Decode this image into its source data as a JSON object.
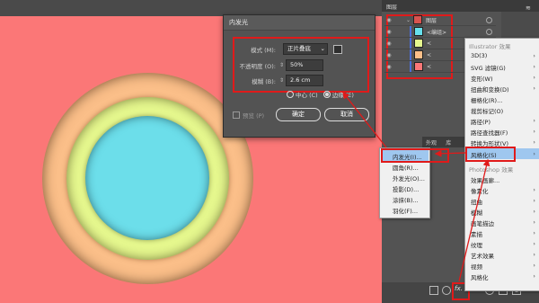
{
  "dialog": {
    "title": "内发光",
    "mode_label": "模式 (M):",
    "mode_value": "正片叠底",
    "opacity_label": "不透明度 (O):",
    "opacity_value": "50%",
    "blur_label": "模糊 (B):",
    "blur_value": "2.6 cm",
    "center_label": "中心 (C)",
    "edge_label": "边缘 (E)",
    "preview_label": "预览 (P)",
    "ok_label": "确定",
    "cancel_label": "取消"
  },
  "layers": {
    "tab_label": "图层",
    "rows": [
      {
        "name": "图层",
        "color": "#d9534f"
      },
      {
        "name": "<编组>",
        "color": "#66e0ec"
      },
      {
        "name": "<",
        "color": "#e6f88e"
      },
      {
        "name": "<",
        "color": "#fbbf89"
      },
      {
        "name": "<",
        "color": "#fb7777"
      }
    ]
  },
  "subtabs": [
    "外观",
    "库"
  ],
  "effects_menu": {
    "header_illustrator": "Illustrator 效果",
    "items_illustrator": [
      "3D(3)",
      "SVG 滤镜(G)",
      "变形(W)",
      "扭曲和变换(D)",
      "栅格化(R)...",
      "裁剪标记(O)",
      "路径(P)",
      "路径查找器(F)",
      "转换为形状(V)",
      "风格化(S)"
    ],
    "header_photoshop": "Photoshop 效果",
    "items_photoshop": [
      "效果画廊...",
      "像素化",
      "扭曲",
      "模糊",
      "画笔描边",
      "素描",
      "纹理",
      "艺术效果",
      "视频",
      "风格化"
    ]
  },
  "stylize_submenu": {
    "items": [
      "内发光(I)...",
      "圆角(R)...",
      "外发光(O)...",
      "投影(D)...",
      "涂抹(B)...",
      "羽化(F)..."
    ]
  },
  "bottom_bar": {
    "fx_label": "fx."
  },
  "colors": {
    "canvas": "#fb7777",
    "ring_outer": "#fbbf89",
    "ring_mid": "#e6f88e",
    "ring_inner": "#6cdeea",
    "highlight": "#e01a1a"
  }
}
